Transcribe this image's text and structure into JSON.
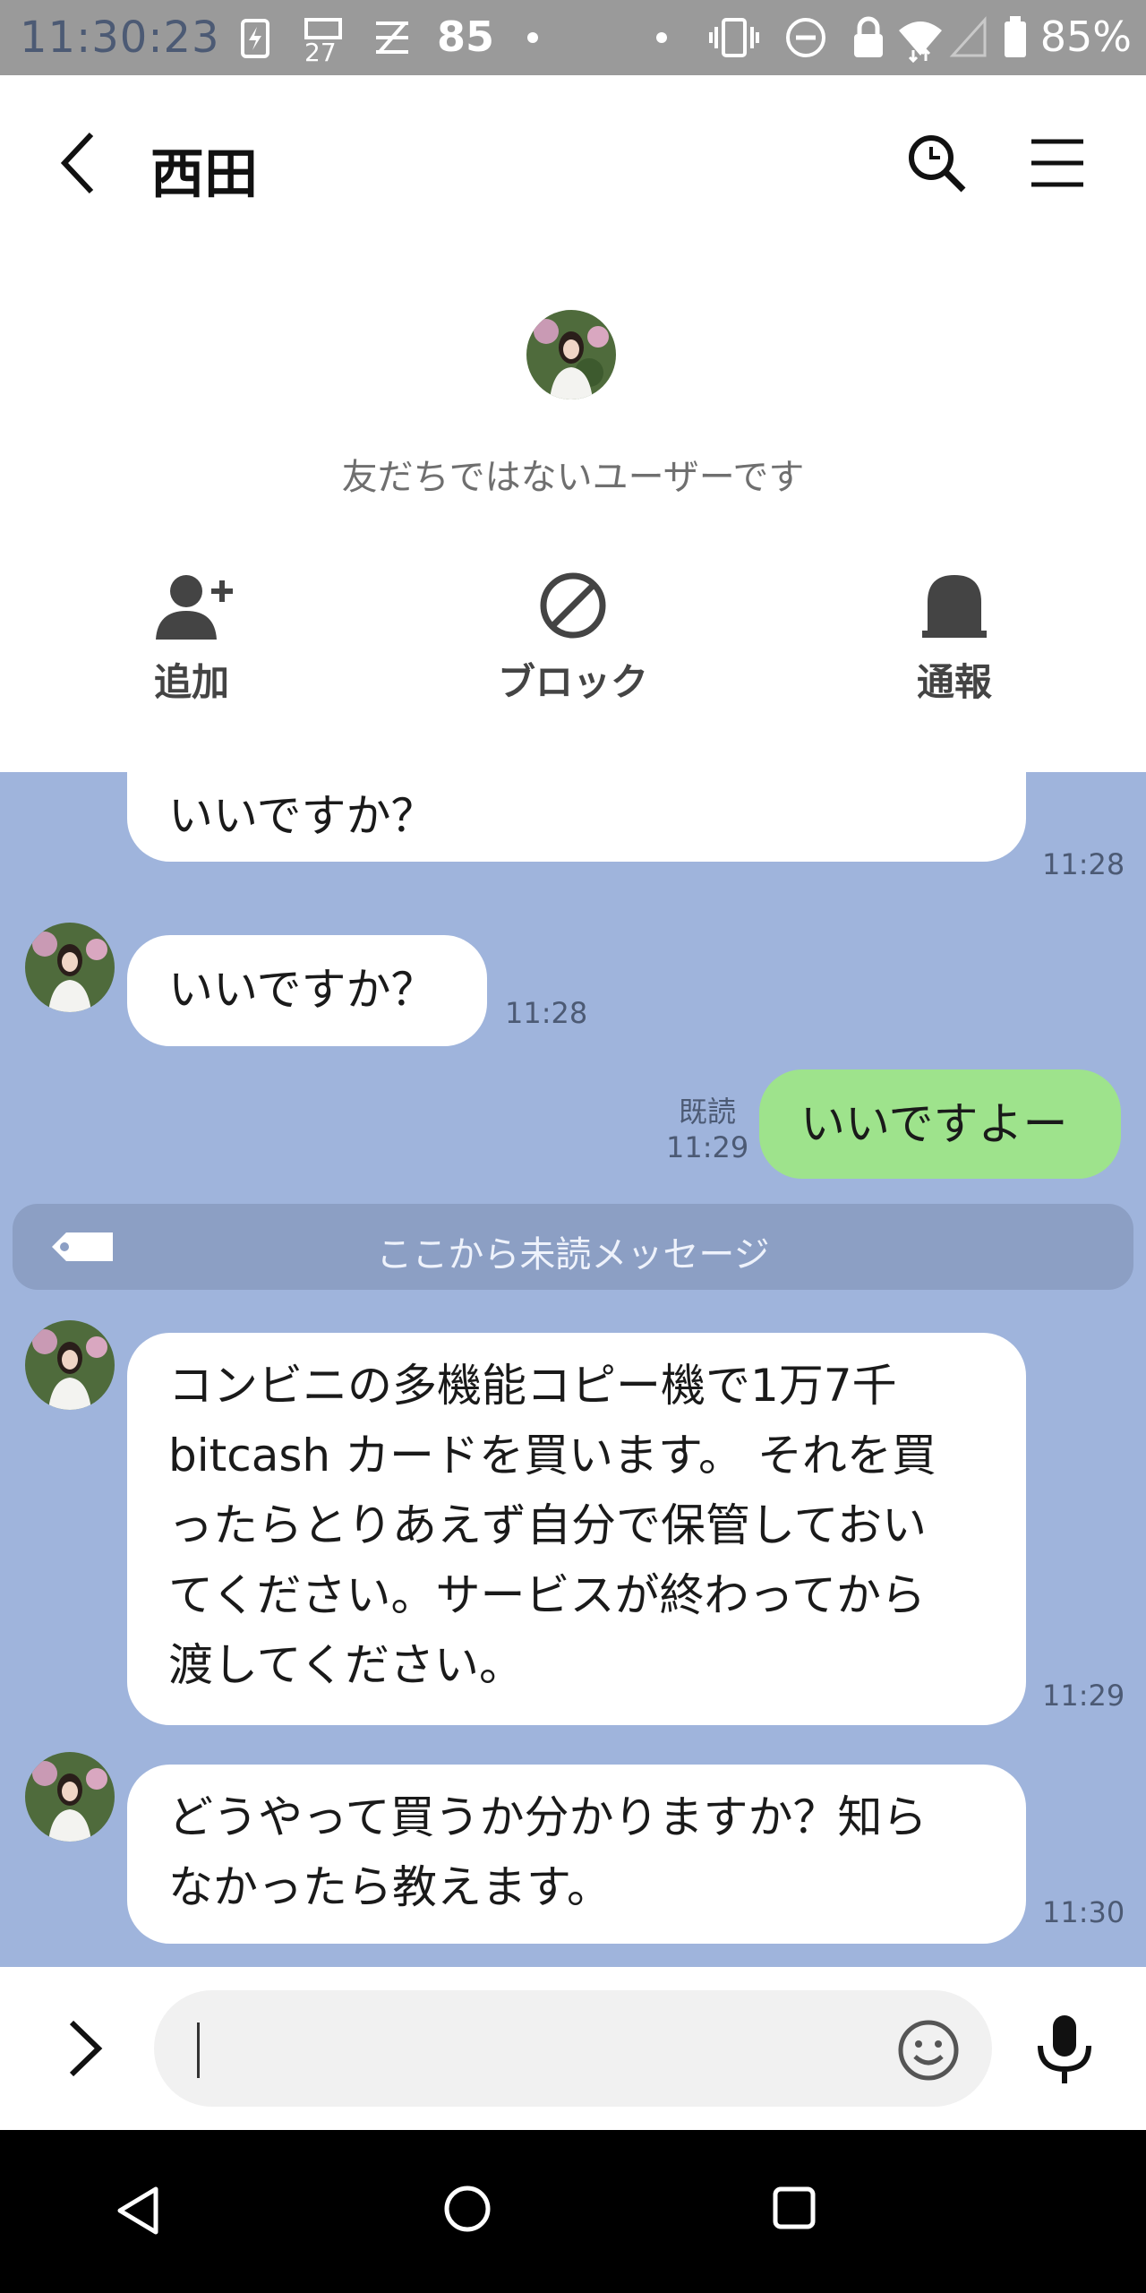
{
  "status_bar": {
    "time": "11:30:23",
    "notif_number": "85",
    "battery_percent": "85%",
    "icons": [
      "battery-charging-icon",
      "calendar-icon",
      "app-s-icon",
      "dot-icon",
      "vibrate-icon",
      "dnd-icon",
      "lock-icon",
      "wifi-icon",
      "signal-icon",
      "battery-icon"
    ]
  },
  "header": {
    "title": "西田",
    "icons": [
      "back-icon",
      "search-icon",
      "menu-icon"
    ]
  },
  "profile": {
    "notice": "友だちではないユーザーです",
    "actions": [
      {
        "label": "追加",
        "icon": "add-friend-icon"
      },
      {
        "label": "ブロック",
        "icon": "block-icon"
      },
      {
        "label": "通報",
        "icon": "report-icon"
      }
    ]
  },
  "messages": [
    {
      "sender": "other",
      "text_line1": "いいですか？",
      "time": "11:28",
      "partial": true
    },
    {
      "sender": "other",
      "text": "いいですか？",
      "time": "11:28"
    },
    {
      "sender": "me",
      "text": "いいですよー",
      "read": "既読",
      "time": "11:29"
    },
    {
      "sender": "other",
      "lines": [
        "コンビニの多機能コピー機で1万7千",
        "bitcash カードを買います。 それを買",
        "ったらとりあえず自分で保管しておい",
        "てください。サービスが終わってから",
        "渡してください。"
      ],
      "time": "11:29"
    },
    {
      "sender": "other",
      "lines": [
        "どうやって買うか分かりますか？知ら",
        "なかったら教えます。"
      ],
      "time": "11:30"
    }
  ],
  "unread_divider": "ここから未読メッセージ",
  "input": {
    "value": "",
    "icons": [
      "expand-icon",
      "emoji-icon",
      "mic-icon"
    ]
  },
  "nav": {
    "icons": [
      "nav-back-icon",
      "nav-home-icon",
      "nav-recents-icon"
    ]
  },
  "colors": {
    "chat_bg": "#9fb4dc",
    "my_bubble": "#9ee38c",
    "status_bar": "#9a9a9a"
  }
}
